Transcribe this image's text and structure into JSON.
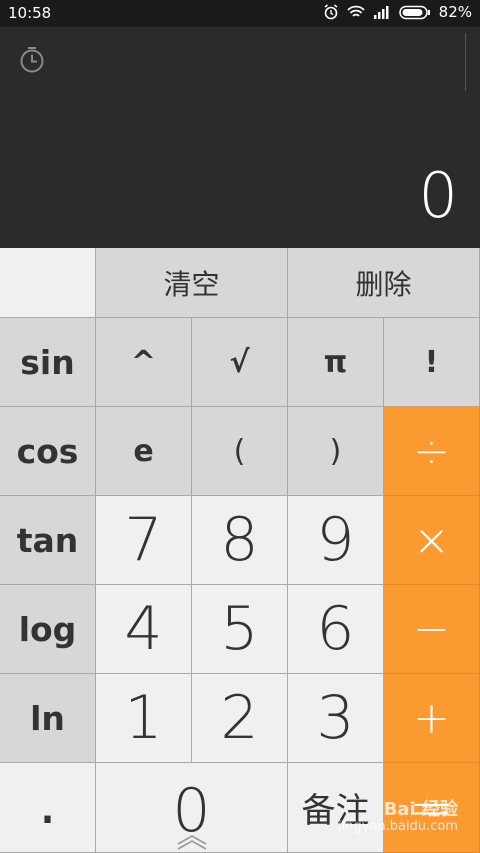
{
  "status": {
    "time": "10:58",
    "battery": "82%"
  },
  "display": {
    "value": "0"
  },
  "keys": {
    "clear": "清空",
    "delete": "删除",
    "sin": "sin",
    "pow": "^",
    "sqrt": "√",
    "pi": "π",
    "fact": "!",
    "cos": "cos",
    "e": "e",
    "lparen": "(",
    "rparen": ")",
    "divide": "÷",
    "tan": "tan",
    "n7": "7",
    "n8": "8",
    "n9": "9",
    "multiply": "×",
    "log": "log",
    "n4": "4",
    "n5": "5",
    "n6": "6",
    "minus": "−",
    "ln": "ln",
    "n1": "1",
    "n2": "2",
    "n3": "3",
    "plus": "+",
    "dot": ".",
    "n0": "0",
    "note": "备注",
    "equals": "="
  },
  "watermark": {
    "line1": "Bai 经验",
    "line2": "jingyan.baidu.com"
  },
  "colors": {
    "accent": "#fb9a30",
    "display_bg": "#2b2b2b"
  }
}
